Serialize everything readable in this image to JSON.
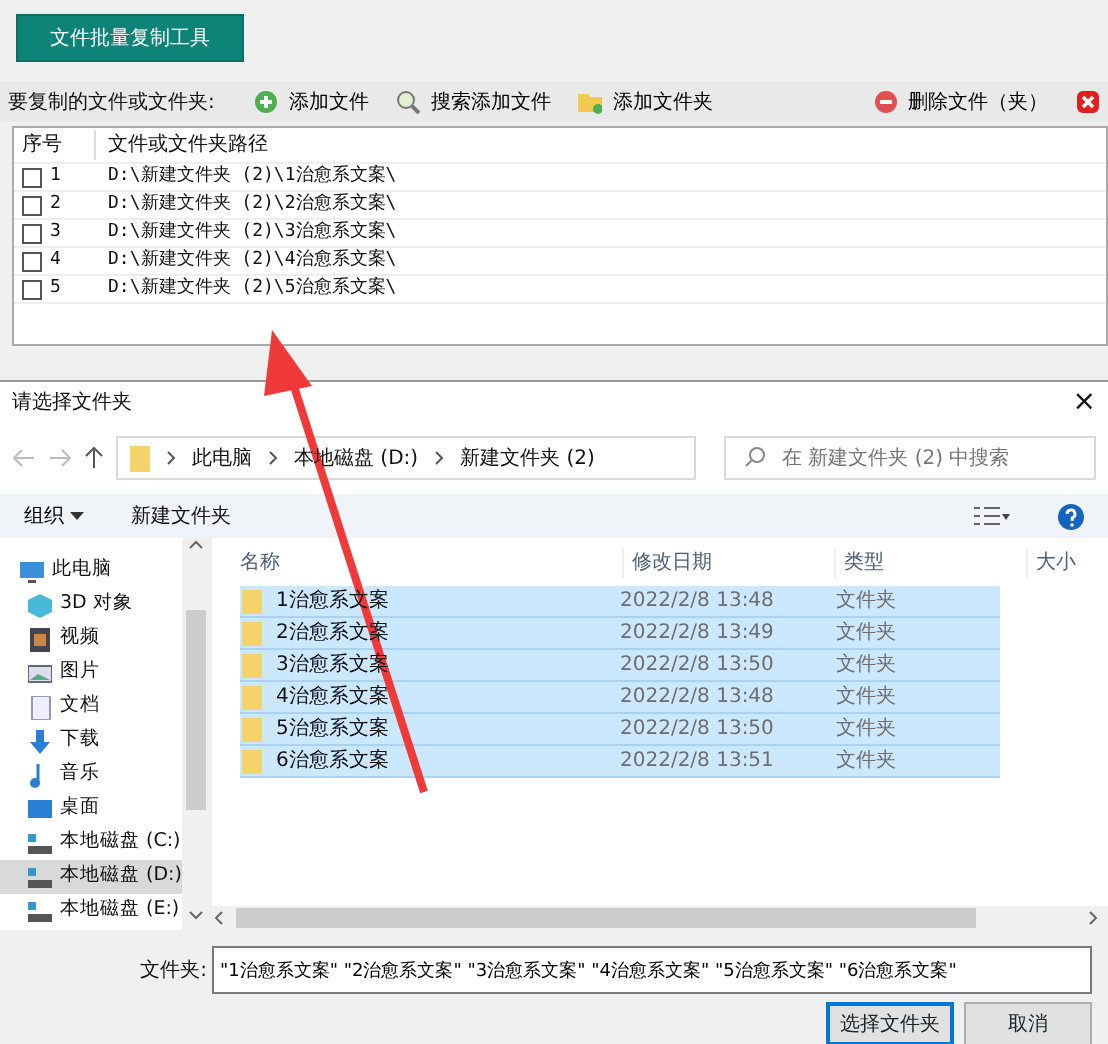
{
  "app": {
    "title_button": "文件批量复制工具",
    "list_label": "要复制的文件或文件夹:",
    "toolbar": [
      {
        "kind": "add",
        "label": "添加文件"
      },
      {
        "kind": "search",
        "label": "搜索添加文件"
      },
      {
        "kind": "folder",
        "label": "添加文件夹"
      },
      {
        "kind": "remove",
        "label": "删除文件（夹）"
      },
      {
        "kind": "clear"
      }
    ],
    "columns": [
      "序号",
      "文件或文件夹路径"
    ],
    "rows": [
      {
        "number": "1",
        "path": "D:\\新建文件夹 (2)\\1治愈系文案\\",
        "checked": false
      },
      {
        "number": "2",
        "path": "D:\\新建文件夹 (2)\\2治愈系文案\\",
        "checked": false
      },
      {
        "number": "3",
        "path": "D:\\新建文件夹 (2)\\3治愈系文案\\",
        "checked": false
      },
      {
        "number": "4",
        "path": "D:\\新建文件夹 (2)\\4治愈系文案\\",
        "checked": false
      },
      {
        "number": "5",
        "path": "D:\\新建文件夹 (2)\\5治愈系文案\\",
        "checked": false
      }
    ]
  },
  "dialog": {
    "title": "请选择文件夹",
    "close": "×",
    "breadcrumb": [
      "此电脑",
      "本地磁盘 (D:)",
      "新建文件夹 (2)"
    ],
    "search": {
      "placeholder": "在 新建文件夹 (2) 中搜索"
    },
    "toolbar": {
      "organize": "组织",
      "new_folder": "新建文件夹"
    },
    "nav": [
      {
        "label": "此电脑",
        "kind": "pc",
        "selected": false,
        "children": [
          {
            "label": "3D 对象",
            "kind": "cube",
            "selected": false
          },
          {
            "label": "视频",
            "kind": "video",
            "selected": false
          },
          {
            "label": "图片",
            "kind": "image",
            "selected": false
          },
          {
            "label": "文档",
            "kind": "doc",
            "selected": false
          },
          {
            "label": "下载",
            "kind": "download",
            "selected": false
          },
          {
            "label": "音乐",
            "kind": "music",
            "selected": false
          },
          {
            "label": "桌面",
            "kind": "desktop",
            "selected": false
          },
          {
            "label": "本地磁盘 (C:)",
            "kind": "drive",
            "selected": false
          },
          {
            "label": "本地磁盘 (D:)",
            "kind": "drive",
            "selected": true
          },
          {
            "label": "本地磁盘 (E:)",
            "kind": "drive",
            "selected": false
          }
        ]
      }
    ],
    "columns": [
      "名称",
      "修改日期",
      "类型",
      "大小"
    ],
    "files": [
      {
        "name": "1治愈系文案",
        "date": "2022/2/8 13:48",
        "type": "文件夹",
        "selected": true
      },
      {
        "name": "2治愈系文案",
        "date": "2022/2/8 13:49",
        "type": "文件夹",
        "selected": true
      },
      {
        "name": "3治愈系文案",
        "date": "2022/2/8 13:50",
        "type": "文件夹",
        "selected": true
      },
      {
        "name": "4治愈系文案",
        "date": "2022/2/8 13:48",
        "type": "文件夹",
        "selected": true
      },
      {
        "name": "5治愈系文案",
        "date": "2022/2/8 13:50",
        "type": "文件夹",
        "selected": true
      },
      {
        "name": "6治愈系文案",
        "date": "2022/2/8 13:51",
        "type": "文件夹",
        "selected": true
      }
    ],
    "folder_label": "文件夹:",
    "folder_value": "\"1治愈系文案\" \"2治愈系文案\" \"3治愈系文案\" \"4治愈系文案\" \"5治愈系文案\" \"6治愈系文案\"",
    "buttons": [
      {
        "label": "选择文件夹",
        "kind": "primary"
      },
      {
        "label": "取消",
        "kind": "secondary"
      }
    ]
  }
}
